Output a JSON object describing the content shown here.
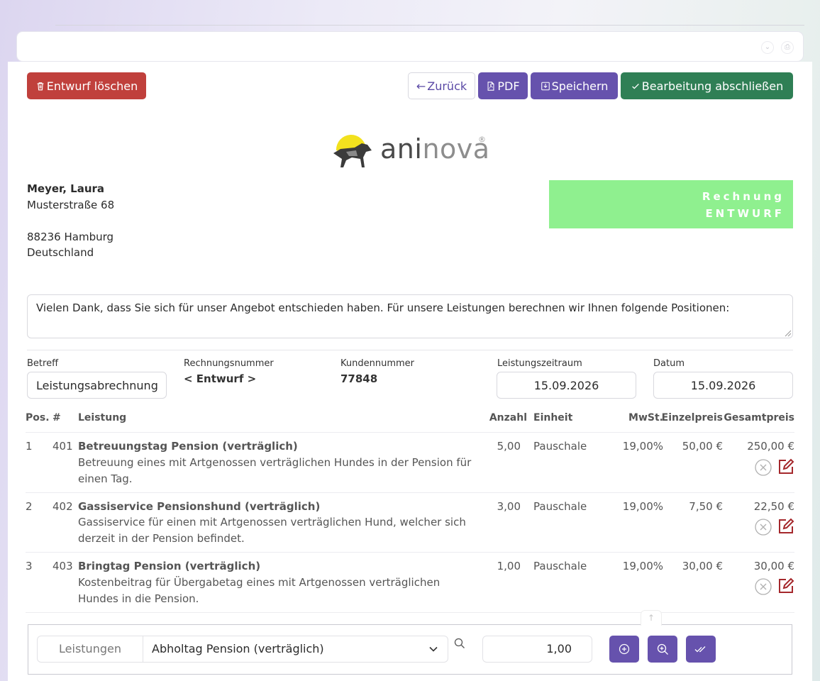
{
  "toolbar": {
    "delete_label": "Entwurf löschen",
    "back_label": "Zurück",
    "pdf_label": "PDF",
    "save_label": "Speichern",
    "finish_label": "Bearbeitung abschließen"
  },
  "logo": {
    "part1": "ani",
    "part2": "nova",
    "reg": "®"
  },
  "customer": {
    "name": "Meyer, Laura",
    "street": "Musterstraße 68",
    "city": "88236 Hamburg",
    "country": "Deutschland"
  },
  "status": {
    "line1": "Rechnung",
    "line2": "ENTWURF",
    "color": "#8ff08f"
  },
  "intro_text": "Vielen Dank, dass Sie sich für unser Angebot entschieden haben. Für unsere Leistungen berechnen wir Ihnen folgende Positionen:",
  "fields": {
    "subject_label": "Betreff",
    "subject_value": "Leistungsabrechnung",
    "invoice_no_label": "Rechnungsnummer",
    "invoice_no_value": "< Entwurf >",
    "customer_no_label": "Kundennummer",
    "customer_no_value": "77848",
    "period_label": "Leistungszeitraum",
    "period_value": "15.09.2026",
    "date_label": "Datum",
    "date_value": "15.09.2026"
  },
  "table": {
    "headers": {
      "pos": "Pos.",
      "num": "#",
      "service": "Leistung",
      "qty": "Anzahl",
      "unit": "Einheit",
      "vat": "MwSt.",
      "unit_price": "Einzelpreis",
      "total": "Gesamtpreis"
    },
    "rows": [
      {
        "pos": "1",
        "num": "401",
        "title": "Betreuungstag Pension (verträglich)",
        "desc": "Betreuung eines mit Artgenossen verträglichen Hundes in der Pension für einen Tag.",
        "qty": "5,00",
        "unit": "Pauschale",
        "vat": "19,00%",
        "unit_price": "50,00 €",
        "total": "250,00 €"
      },
      {
        "pos": "2",
        "num": "402",
        "title": "Gassiservice Pensionshund (verträglich)",
        "desc": "Gassiservice für einen mit Artgenossen verträglichen Hund, welcher sich derzeit in der Pension befindet.",
        "qty": "3,00",
        "unit": "Pauschale",
        "vat": "19,00%",
        "unit_price": "7,50 €",
        "total": "22,50 €"
      },
      {
        "pos": "3",
        "num": "403",
        "title": "Bringtag Pension (verträglich)",
        "desc": "Kostenbeitrag für Übergabetag eines mit Artgenossen verträglichen Hundes in die Pension.",
        "qty": "1,00",
        "unit": "Pauschale",
        "vat": "19,00%",
        "unit_price": "30,00 €",
        "total": "30,00 €"
      }
    ]
  },
  "add_item": {
    "category_label": "Leistungen",
    "selected_service": "Abholtag Pension (verträglich)",
    "quantity": "1,00"
  },
  "colors": {
    "danger": "#c0403c",
    "primary": "#6652ad",
    "success": "#2f7f55",
    "edit_icon": "#a5282c"
  }
}
